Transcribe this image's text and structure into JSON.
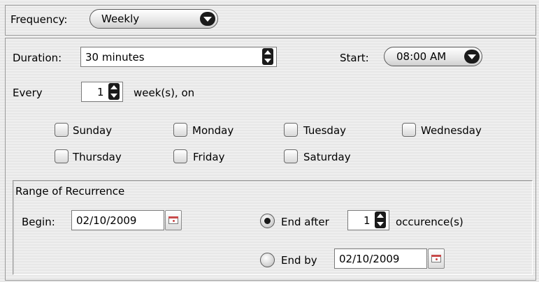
{
  "frequency": {
    "label": "Frequency:",
    "value": "Weekly"
  },
  "duration": {
    "label": "Duration:",
    "value": "30 minutes"
  },
  "start": {
    "label": "Start:",
    "value": "08:00 AM"
  },
  "every": {
    "label": "Every",
    "value": "1",
    "suffix": "week(s), on"
  },
  "days": {
    "sunday": "Sunday",
    "monday": "Monday",
    "tuesday": "Tuesday",
    "wednesday": "Wednesday",
    "thursday": "Thursday",
    "friday": "Friday",
    "saturday": "Saturday"
  },
  "range": {
    "title": "Range of Recurrence",
    "begin_label": "Begin:",
    "begin_value": "02/10/2009",
    "end_after_label": "End after",
    "end_after_value": "1",
    "occurrences_label": "occurence(s)",
    "end_by_label": "End by",
    "end_by_value": "02/10/2009",
    "selected": "end_after"
  }
}
